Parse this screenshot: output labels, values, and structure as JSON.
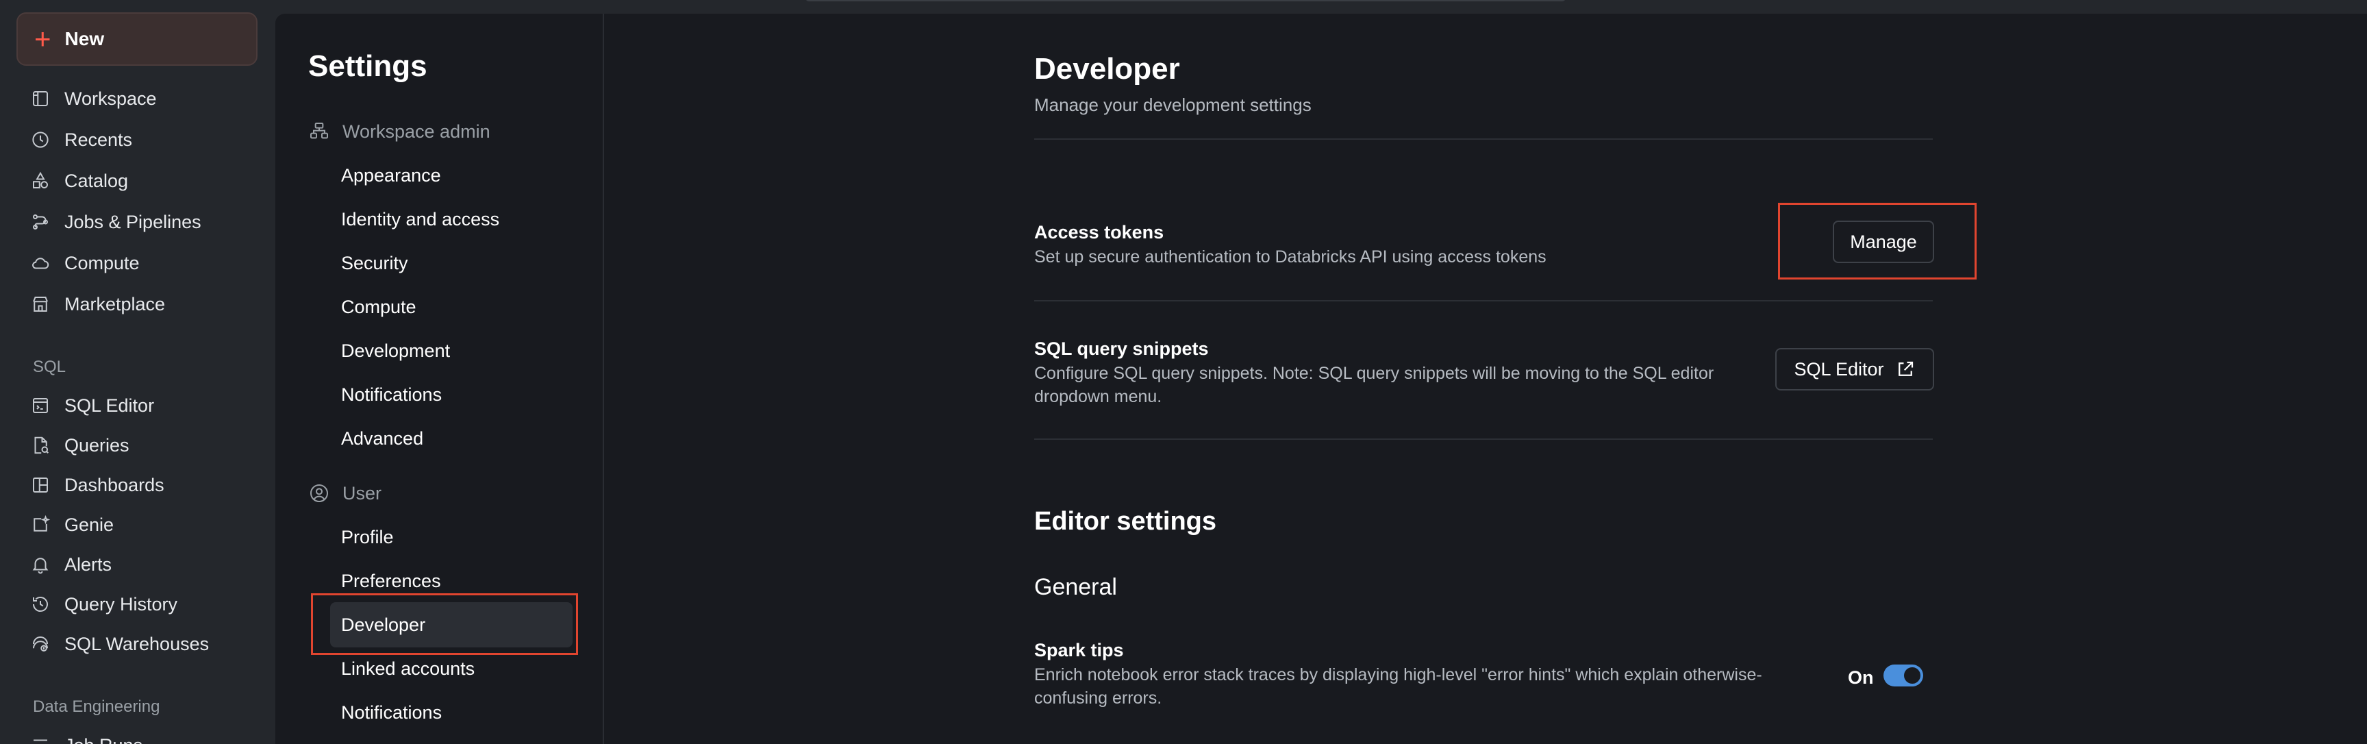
{
  "leftnav": {
    "new_label": "New",
    "items": [
      {
        "label": "Workspace",
        "icon": "workspace-icon"
      },
      {
        "label": "Recents",
        "icon": "clock-icon"
      },
      {
        "label": "Catalog",
        "icon": "catalog-icon"
      },
      {
        "label": "Jobs & Pipelines",
        "icon": "jobs-icon"
      },
      {
        "label": "Compute",
        "icon": "cloud-icon"
      },
      {
        "label": "Marketplace",
        "icon": "store-icon"
      }
    ],
    "sql_section": "SQL",
    "sql_items": [
      {
        "label": "SQL Editor",
        "icon": "sql-editor-icon"
      },
      {
        "label": "Queries",
        "icon": "queries-icon"
      },
      {
        "label": "Dashboards",
        "icon": "dashboards-icon"
      },
      {
        "label": "Genie",
        "icon": "genie-icon"
      },
      {
        "label": "Alerts",
        "icon": "bell-icon"
      },
      {
        "label": "Query History",
        "icon": "history-icon"
      },
      {
        "label": "SQL Warehouses",
        "icon": "warehouse-icon"
      }
    ],
    "data_eng_section": "Data Engineering",
    "partial_item": "Job Runs"
  },
  "settings": {
    "title": "Settings",
    "workspace_admin": "Workspace admin",
    "workspace_items": [
      "Appearance",
      "Identity and access",
      "Security",
      "Compute",
      "Development",
      "Notifications",
      "Advanced"
    ],
    "user": "User",
    "user_items": [
      "Profile",
      "Preferences",
      "Developer",
      "Linked accounts",
      "Notifications"
    ]
  },
  "developer": {
    "title": "Developer",
    "subtitle": "Manage your development settings",
    "access_tokens": {
      "title": "Access tokens",
      "desc": "Set up secure authentication to Databricks API using access tokens",
      "button": "Manage"
    },
    "sql_snippets": {
      "title": "SQL query snippets",
      "desc": "Configure SQL query snippets. Note: SQL query snippets will be moving to the SQL editor dropdown menu.",
      "button": "SQL Editor"
    },
    "editor_settings": "Editor settings",
    "general": "General",
    "spark_tips": {
      "title": "Spark tips",
      "desc": "Enrich notebook error stack traces by displaying high-level \"error hints\" which explain otherwise-confusing errors.",
      "toggle_label": "On",
      "enabled": true
    }
  },
  "colors": {
    "accent_red": "#e0452f",
    "toggle_blue": "#4a8fdc",
    "panel_bg": "#181a1f",
    "nav_bg": "#24272c"
  }
}
